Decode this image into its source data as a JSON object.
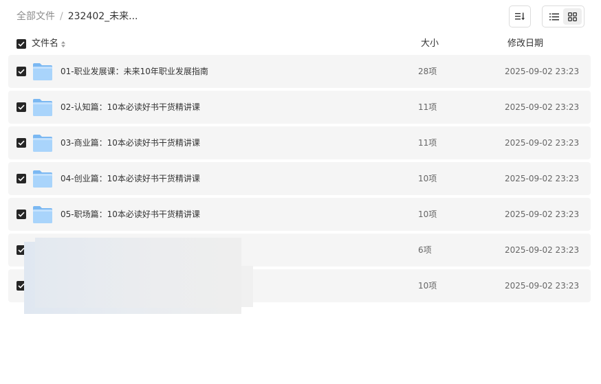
{
  "breadcrumb": {
    "root": "全部文件",
    "separator": "/",
    "current": "232402_未来..."
  },
  "toolbar": {
    "sort_icon": "sort-desc-icon",
    "view_list_icon": "list-view-icon",
    "view_grid_icon": "grid-view-icon",
    "active_view": "list"
  },
  "table": {
    "columns": {
      "name": "文件名",
      "size": "大小",
      "modified": "修改日期"
    },
    "select_all_checked": true,
    "rows": [
      {
        "name": "01-职业发展课：未来10年职业发展指南",
        "size": "28项",
        "modified": "2025-09-02 23:23",
        "checked": true,
        "icon": "folder-icon"
      },
      {
        "name": "02-认知篇：10本必读好书干货精讲课",
        "size": "11项",
        "modified": "2025-09-02 23:23",
        "checked": true,
        "icon": "folder-icon"
      },
      {
        "name": "03-商业篇：10本必读好书干货精讲课",
        "size": "11项",
        "modified": "2025-09-02 23:23",
        "checked": true,
        "icon": "folder-icon"
      },
      {
        "name": "04-创业篇：10本必读好书干货精讲课",
        "size": "10项",
        "modified": "2025-09-02 23:23",
        "checked": true,
        "icon": "folder-icon"
      },
      {
        "name": "05-职场篇：10本必读好书干货精讲课",
        "size": "10项",
        "modified": "2025-09-02 23:23",
        "checked": true,
        "icon": "folder-icon"
      },
      {
        "name": "",
        "size": "6项",
        "modified": "2025-09-02 23:23",
        "checked": true,
        "icon": "folder-icon"
      },
      {
        "name": "",
        "size": "10项",
        "modified": "2025-09-02 23:23",
        "checked": true,
        "icon": "folder-icon"
      }
    ]
  },
  "colors": {
    "row_background": "#f5f5f5",
    "checkbox": "#262626",
    "folder_light": "#a9d4fb",
    "folder_dark": "#7bb8f2"
  }
}
